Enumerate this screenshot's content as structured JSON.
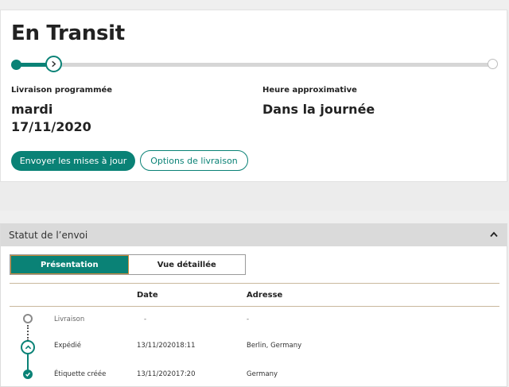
{
  "status": {
    "title": "En Transit",
    "progress_fraction": 0.08
  },
  "delivery": {
    "scheduled_label": "Livraison programmée",
    "scheduled_day": "mardi",
    "scheduled_date": "17/11/2020",
    "time_label": "Heure approximative",
    "time_value": "Dans la journée"
  },
  "actions": {
    "updates_label": "Envoyer les mises à jour",
    "options_label": "Options de livraison"
  },
  "shipment": {
    "section_title": "Statut de l’envoi",
    "tabs": {
      "overview": "Présentation",
      "detailed": "Vue détaillée"
    },
    "columns": {
      "date": "Date",
      "address": "Adresse"
    },
    "events": [
      {
        "status": "Livraison",
        "date": "-",
        "time": "",
        "address": "-"
      },
      {
        "status": "Expédié",
        "date": "13/11/2020",
        "time": "18:11",
        "address": "Berlin, Germany"
      },
      {
        "status": "Étiquette créée",
        "date": "13/11/2020",
        "time": "17:20",
        "address": "Germany"
      }
    ]
  },
  "colors": {
    "accent": "#0a8276",
    "track": "#d6d6d6",
    "header_bg": "#dadada"
  },
  "icons": {
    "current_step": "chevron-right-icon",
    "collapse": "chevron-up-icon",
    "timeline_current": "chevron-up-icon",
    "timeline_done": "check-icon"
  }
}
